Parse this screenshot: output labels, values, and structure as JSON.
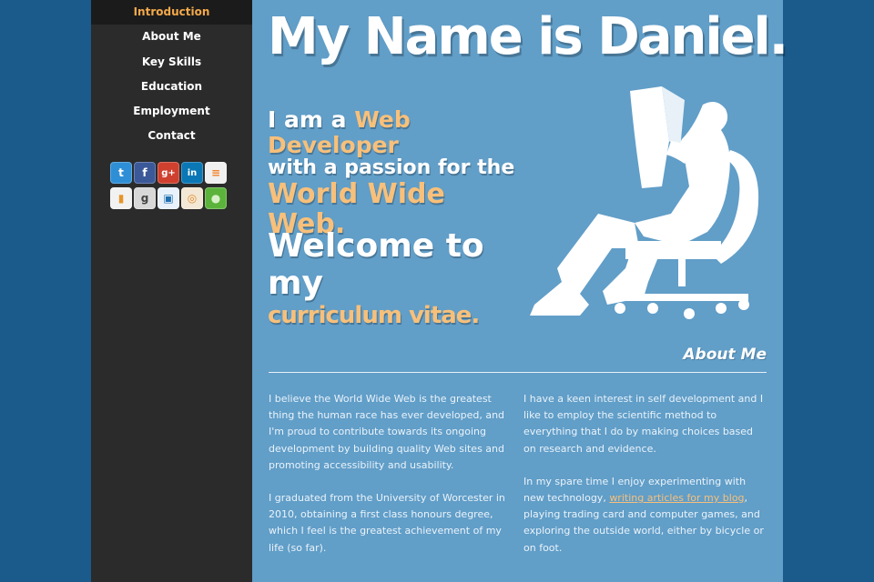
{
  "nav": {
    "items": [
      {
        "label": "Introduction",
        "active": true
      },
      {
        "label": "About Me"
      },
      {
        "label": "Key Skills"
      },
      {
        "label": "Education"
      },
      {
        "label": "Employment"
      },
      {
        "label": "Contact"
      }
    ]
  },
  "social_icons": [
    {
      "name": "twitter-icon",
      "glyph": "t",
      "color": "#2f8fd6"
    },
    {
      "name": "facebook-icon",
      "glyph": "f",
      "color": "#3b5998"
    },
    {
      "name": "google-plus-icon",
      "glyph": "g+",
      "color": "#d0402f"
    },
    {
      "name": "linkedin-icon",
      "glyph": "in",
      "color": "#0b77b5"
    },
    {
      "name": "stackoverflow-icon",
      "glyph": "≡",
      "color": "#f48024"
    },
    {
      "name": "rss-icon",
      "glyph": "▮",
      "color": "#e8942a"
    },
    {
      "name": "goodreads-icon",
      "glyph": "g",
      "color": "#8a8a8a"
    },
    {
      "name": "stack-icon",
      "glyph": "▣",
      "color": "#1f6fb0"
    },
    {
      "name": "target-icon",
      "glyph": "◎",
      "color": "#e38c2c"
    },
    {
      "name": "leaf-icon",
      "glyph": "●",
      "color": "#5bb33c"
    }
  ],
  "hero": {
    "title": "My Name is Daniel.",
    "tagline": {
      "line1_prefix": "I am a ",
      "line1_highlight": "Web Developer",
      "line2": "with a passion for the",
      "line3": "World Wide Web."
    },
    "welcome": {
      "line1": "Welcome to my",
      "line2": "curriculum vitae."
    }
  },
  "about": {
    "title": "About Me",
    "left": [
      "I believe the World Wide Web is the greatest thing the human race has ever developed, and I'm proud to contribute towards its ongoing development by building quality Web sites and promoting accessibility and usability.",
      "I graduated from the University of Worcester in 2010, obtaining a first class honours degree, which I feel is the greatest achievement of my life (so far)."
    ],
    "right_p1": "I have a keen interest in self development and I like to employ the scientific method to everything that I do by making choices based on research and evidence.",
    "right_p2_before": "In my spare time I enjoy experimenting with new technology, ",
    "right_p2_link": "writing articles for my blog",
    "right_p2_after": ", playing trading card and computer games, and exploring the outside world, either by bicycle or on foot."
  }
}
